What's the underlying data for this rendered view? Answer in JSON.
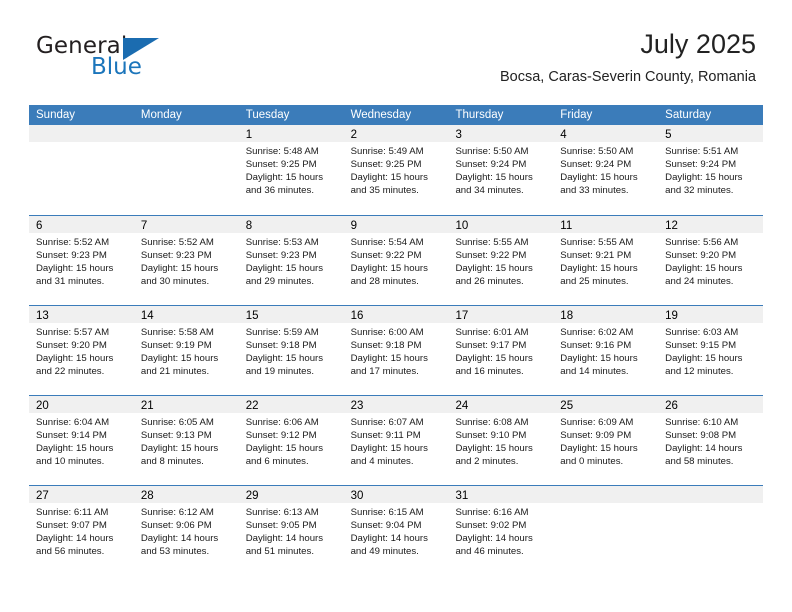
{
  "logo": {
    "primary_text": "General",
    "secondary_text": "Blue",
    "triangle_color": "#1b6cb0",
    "blue_color": "#1b75bb"
  },
  "header": {
    "title": "July 2025",
    "subtitle": "Bocsa, Caras-Severin County, Romania"
  },
  "theme": {
    "header_blue": "#3b7cba",
    "daynum_band": "#f0f0f0",
    "text": "#000000"
  },
  "weekdays": [
    "Sunday",
    "Monday",
    "Tuesday",
    "Wednesday",
    "Thursday",
    "Friday",
    "Saturday"
  ],
  "weeks": [
    [
      {
        "day": "",
        "lines": []
      },
      {
        "day": "",
        "lines": []
      },
      {
        "day": "1",
        "lines": [
          "Sunrise: 5:48 AM",
          "Sunset: 9:25 PM",
          "Daylight: 15 hours",
          "and 36 minutes."
        ]
      },
      {
        "day": "2",
        "lines": [
          "Sunrise: 5:49 AM",
          "Sunset: 9:25 PM",
          "Daylight: 15 hours",
          "and 35 minutes."
        ]
      },
      {
        "day": "3",
        "lines": [
          "Sunrise: 5:50 AM",
          "Sunset: 9:24 PM",
          "Daylight: 15 hours",
          "and 34 minutes."
        ]
      },
      {
        "day": "4",
        "lines": [
          "Sunrise: 5:50 AM",
          "Sunset: 9:24 PM",
          "Daylight: 15 hours",
          "and 33 minutes."
        ]
      },
      {
        "day": "5",
        "lines": [
          "Sunrise: 5:51 AM",
          "Sunset: 9:24 PM",
          "Daylight: 15 hours",
          "and 32 minutes."
        ]
      }
    ],
    [
      {
        "day": "6",
        "lines": [
          "Sunrise: 5:52 AM",
          "Sunset: 9:23 PM",
          "Daylight: 15 hours",
          "and 31 minutes."
        ]
      },
      {
        "day": "7",
        "lines": [
          "Sunrise: 5:52 AM",
          "Sunset: 9:23 PM",
          "Daylight: 15 hours",
          "and 30 minutes."
        ]
      },
      {
        "day": "8",
        "lines": [
          "Sunrise: 5:53 AM",
          "Sunset: 9:23 PM",
          "Daylight: 15 hours",
          "and 29 minutes."
        ]
      },
      {
        "day": "9",
        "lines": [
          "Sunrise: 5:54 AM",
          "Sunset: 9:22 PM",
          "Daylight: 15 hours",
          "and 28 minutes."
        ]
      },
      {
        "day": "10",
        "lines": [
          "Sunrise: 5:55 AM",
          "Sunset: 9:22 PM",
          "Daylight: 15 hours",
          "and 26 minutes."
        ]
      },
      {
        "day": "11",
        "lines": [
          "Sunrise: 5:55 AM",
          "Sunset: 9:21 PM",
          "Daylight: 15 hours",
          "and 25 minutes."
        ]
      },
      {
        "day": "12",
        "lines": [
          "Sunrise: 5:56 AM",
          "Sunset: 9:20 PM",
          "Daylight: 15 hours",
          "and 24 minutes."
        ]
      }
    ],
    [
      {
        "day": "13",
        "lines": [
          "Sunrise: 5:57 AM",
          "Sunset: 9:20 PM",
          "Daylight: 15 hours",
          "and 22 minutes."
        ]
      },
      {
        "day": "14",
        "lines": [
          "Sunrise: 5:58 AM",
          "Sunset: 9:19 PM",
          "Daylight: 15 hours",
          "and 21 minutes."
        ]
      },
      {
        "day": "15",
        "lines": [
          "Sunrise: 5:59 AM",
          "Sunset: 9:18 PM",
          "Daylight: 15 hours",
          "and 19 minutes."
        ]
      },
      {
        "day": "16",
        "lines": [
          "Sunrise: 6:00 AM",
          "Sunset: 9:18 PM",
          "Daylight: 15 hours",
          "and 17 minutes."
        ]
      },
      {
        "day": "17",
        "lines": [
          "Sunrise: 6:01 AM",
          "Sunset: 9:17 PM",
          "Daylight: 15 hours",
          "and 16 minutes."
        ]
      },
      {
        "day": "18",
        "lines": [
          "Sunrise: 6:02 AM",
          "Sunset: 9:16 PM",
          "Daylight: 15 hours",
          "and 14 minutes."
        ]
      },
      {
        "day": "19",
        "lines": [
          "Sunrise: 6:03 AM",
          "Sunset: 9:15 PM",
          "Daylight: 15 hours",
          "and 12 minutes."
        ]
      }
    ],
    [
      {
        "day": "20",
        "lines": [
          "Sunrise: 6:04 AM",
          "Sunset: 9:14 PM",
          "Daylight: 15 hours",
          "and 10 minutes."
        ]
      },
      {
        "day": "21",
        "lines": [
          "Sunrise: 6:05 AM",
          "Sunset: 9:13 PM",
          "Daylight: 15 hours",
          "and 8 minutes."
        ]
      },
      {
        "day": "22",
        "lines": [
          "Sunrise: 6:06 AM",
          "Sunset: 9:12 PM",
          "Daylight: 15 hours",
          "and 6 minutes."
        ]
      },
      {
        "day": "23",
        "lines": [
          "Sunrise: 6:07 AM",
          "Sunset: 9:11 PM",
          "Daylight: 15 hours",
          "and 4 minutes."
        ]
      },
      {
        "day": "24",
        "lines": [
          "Sunrise: 6:08 AM",
          "Sunset: 9:10 PM",
          "Daylight: 15 hours",
          "and 2 minutes."
        ]
      },
      {
        "day": "25",
        "lines": [
          "Sunrise: 6:09 AM",
          "Sunset: 9:09 PM",
          "Daylight: 15 hours",
          "and 0 minutes."
        ]
      },
      {
        "day": "26",
        "lines": [
          "Sunrise: 6:10 AM",
          "Sunset: 9:08 PM",
          "Daylight: 14 hours",
          "and 58 minutes."
        ]
      }
    ],
    [
      {
        "day": "27",
        "lines": [
          "Sunrise: 6:11 AM",
          "Sunset: 9:07 PM",
          "Daylight: 14 hours",
          "and 56 minutes."
        ]
      },
      {
        "day": "28",
        "lines": [
          "Sunrise: 6:12 AM",
          "Sunset: 9:06 PM",
          "Daylight: 14 hours",
          "and 53 minutes."
        ]
      },
      {
        "day": "29",
        "lines": [
          "Sunrise: 6:13 AM",
          "Sunset: 9:05 PM",
          "Daylight: 14 hours",
          "and 51 minutes."
        ]
      },
      {
        "day": "30",
        "lines": [
          "Sunrise: 6:15 AM",
          "Sunset: 9:04 PM",
          "Daylight: 14 hours",
          "and 49 minutes."
        ]
      },
      {
        "day": "31",
        "lines": [
          "Sunrise: 6:16 AM",
          "Sunset: 9:02 PM",
          "Daylight: 14 hours",
          "and 46 minutes."
        ]
      },
      {
        "day": "",
        "lines": []
      },
      {
        "day": "",
        "lines": []
      }
    ]
  ]
}
